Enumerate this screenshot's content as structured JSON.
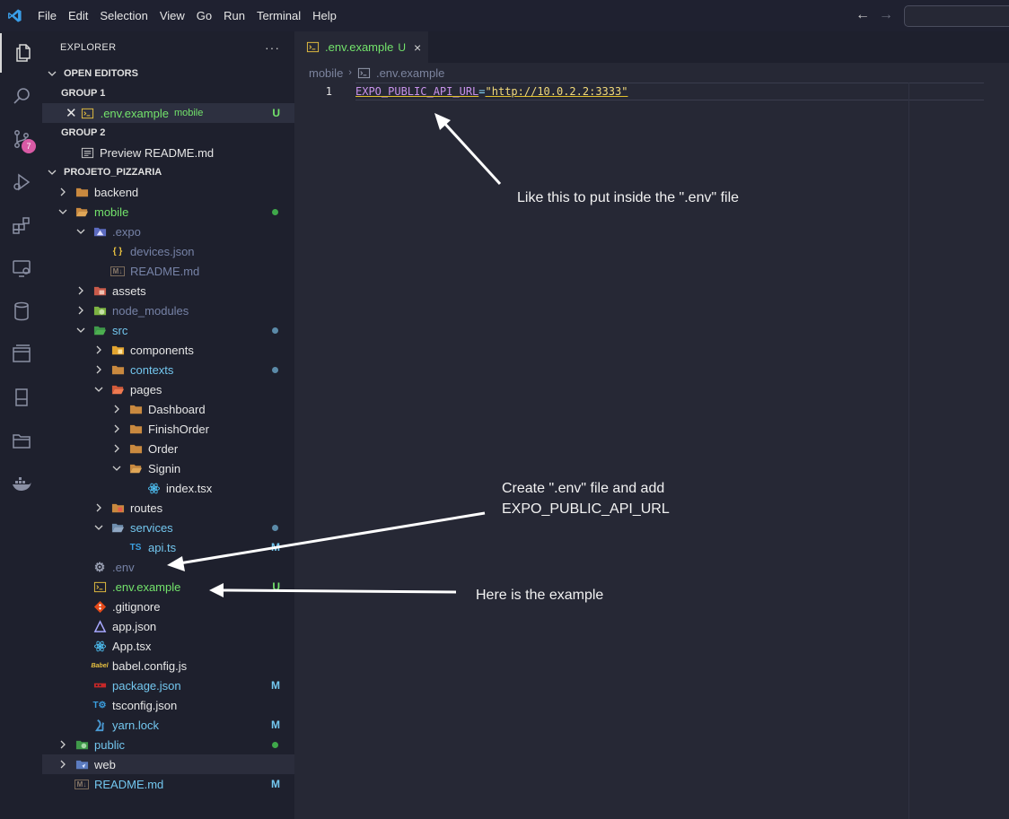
{
  "titlebar": {
    "menu": [
      "File",
      "Edit",
      "Selection",
      "View",
      "Go",
      "Run",
      "Terminal",
      "Help"
    ]
  },
  "activity_bar": {
    "items": [
      "explorer-icon",
      "search-icon",
      "source-control-icon",
      "run-debug-icon",
      "extensions-icon",
      "remote-explorer-icon",
      "database-icon",
      "layout-icon",
      "notebook-icon",
      "folder-icon",
      "docker-icon"
    ],
    "source_control_badge": "7"
  },
  "sidebar": {
    "title": "EXPLORER",
    "more": "···",
    "open_editors": {
      "label": "OPEN EDITORS",
      "group1": {
        "label": "GROUP 1",
        "file": ".env.example",
        "folder": "mobile",
        "status": "U"
      },
      "group2": {
        "label": "GROUP 2",
        "file": "Preview README.md"
      }
    },
    "project": {
      "label": "PROJETO_PIZZARIA",
      "items": [
        {
          "name": "backend"
        },
        {
          "name": "mobile"
        },
        {
          "name": ".expo"
        },
        {
          "name": "devices.json"
        },
        {
          "name": "README.md"
        },
        {
          "name": "assets"
        },
        {
          "name": "node_modules"
        },
        {
          "name": "src"
        },
        {
          "name": "components"
        },
        {
          "name": "contexts"
        },
        {
          "name": "pages"
        },
        {
          "name": "Dashboard"
        },
        {
          "name": "FinishOrder"
        },
        {
          "name": "Order"
        },
        {
          "name": "Signin"
        },
        {
          "name": "index.tsx"
        },
        {
          "name": "routes"
        },
        {
          "name": "services"
        },
        {
          "name": "api.ts",
          "status": "M"
        },
        {
          "name": ".env"
        },
        {
          "name": ".env.example",
          "status": "U"
        },
        {
          "name": ".gitignore"
        },
        {
          "name": "app.json"
        },
        {
          "name": "App.tsx"
        },
        {
          "name": "babel.config.js"
        },
        {
          "name": "package.json",
          "status": "M"
        },
        {
          "name": "tsconfig.json"
        },
        {
          "name": "yarn.lock",
          "status": "M"
        },
        {
          "name": "public"
        },
        {
          "name": "web"
        },
        {
          "name": "README.md",
          "status": "M"
        }
      ]
    }
  },
  "editor": {
    "tab": {
      "label": ".env.example",
      "status": "U",
      "close": "×"
    },
    "breadcrumb": {
      "folder": "mobile",
      "file": ".env.example"
    },
    "lines": [
      {
        "number": "1",
        "key": "EXPO_PUBLIC_API_URL",
        "eq": "=",
        "value": "\"http://10.0.2.2:3333\""
      }
    ]
  },
  "annotations": {
    "top": "Like this to put inside the \".env\" file",
    "middle_line1": "Create \".env\" file and add",
    "middle_line2": "EXPO_PUBLIC_API_URL",
    "bottom": "Here is the example"
  }
}
